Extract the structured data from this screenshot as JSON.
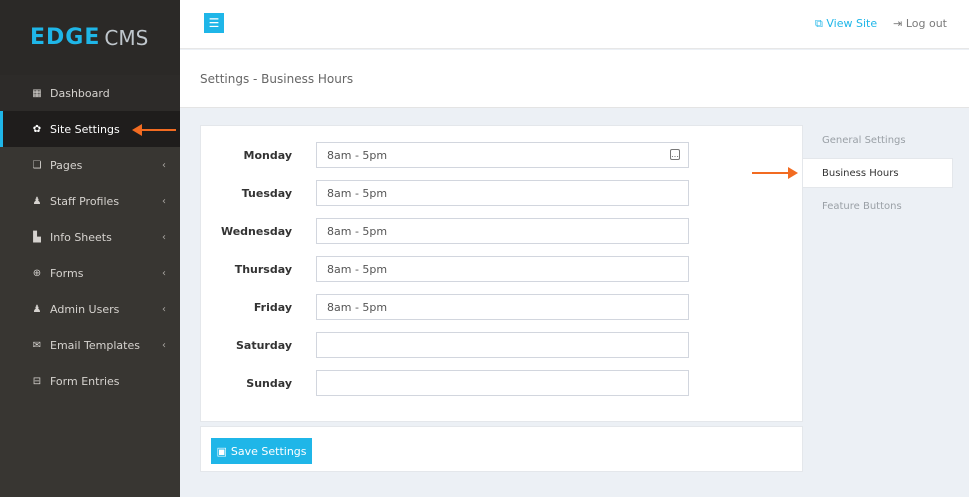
{
  "brand": {
    "name_bold": "EDGE",
    "name_light": "CMS"
  },
  "topbar": {
    "menu_icon": "☰",
    "view_site": "View Site",
    "log_out": "Log out"
  },
  "page": {
    "title": "Settings - Business Hours"
  },
  "sidebar": {
    "items": [
      {
        "label": "Dashboard",
        "icon": "▦"
      },
      {
        "label": "Site Settings",
        "icon": "✿"
      },
      {
        "label": "Pages",
        "icon": "❏"
      },
      {
        "label": "Staff Profiles",
        "icon": "♟"
      },
      {
        "label": "Info Sheets",
        "icon": "▙"
      },
      {
        "label": "Forms",
        "icon": "⊕"
      },
      {
        "label": "Admin Users",
        "icon": "♟"
      },
      {
        "label": "Email Templates",
        "icon": "✉"
      },
      {
        "label": "Form Entries",
        "icon": "⊟"
      }
    ],
    "chevron": "‹"
  },
  "hours": {
    "days": [
      {
        "label": "Monday",
        "value": "8am - 5pm"
      },
      {
        "label": "Tuesday",
        "value": "8am - 5pm"
      },
      {
        "label": "Wednesday",
        "value": "8am - 5pm"
      },
      {
        "label": "Thursday",
        "value": "8am - 5pm"
      },
      {
        "label": "Friday",
        "value": "8am - 5pm"
      },
      {
        "label": "Saturday",
        "value": ""
      },
      {
        "label": "Sunday",
        "value": ""
      }
    ]
  },
  "actions": {
    "save_label": "Save Settings"
  },
  "settings_nav": {
    "items": [
      {
        "label": "General Settings"
      },
      {
        "label": "Business Hours"
      },
      {
        "label": "Feature Buttons"
      }
    ]
  }
}
